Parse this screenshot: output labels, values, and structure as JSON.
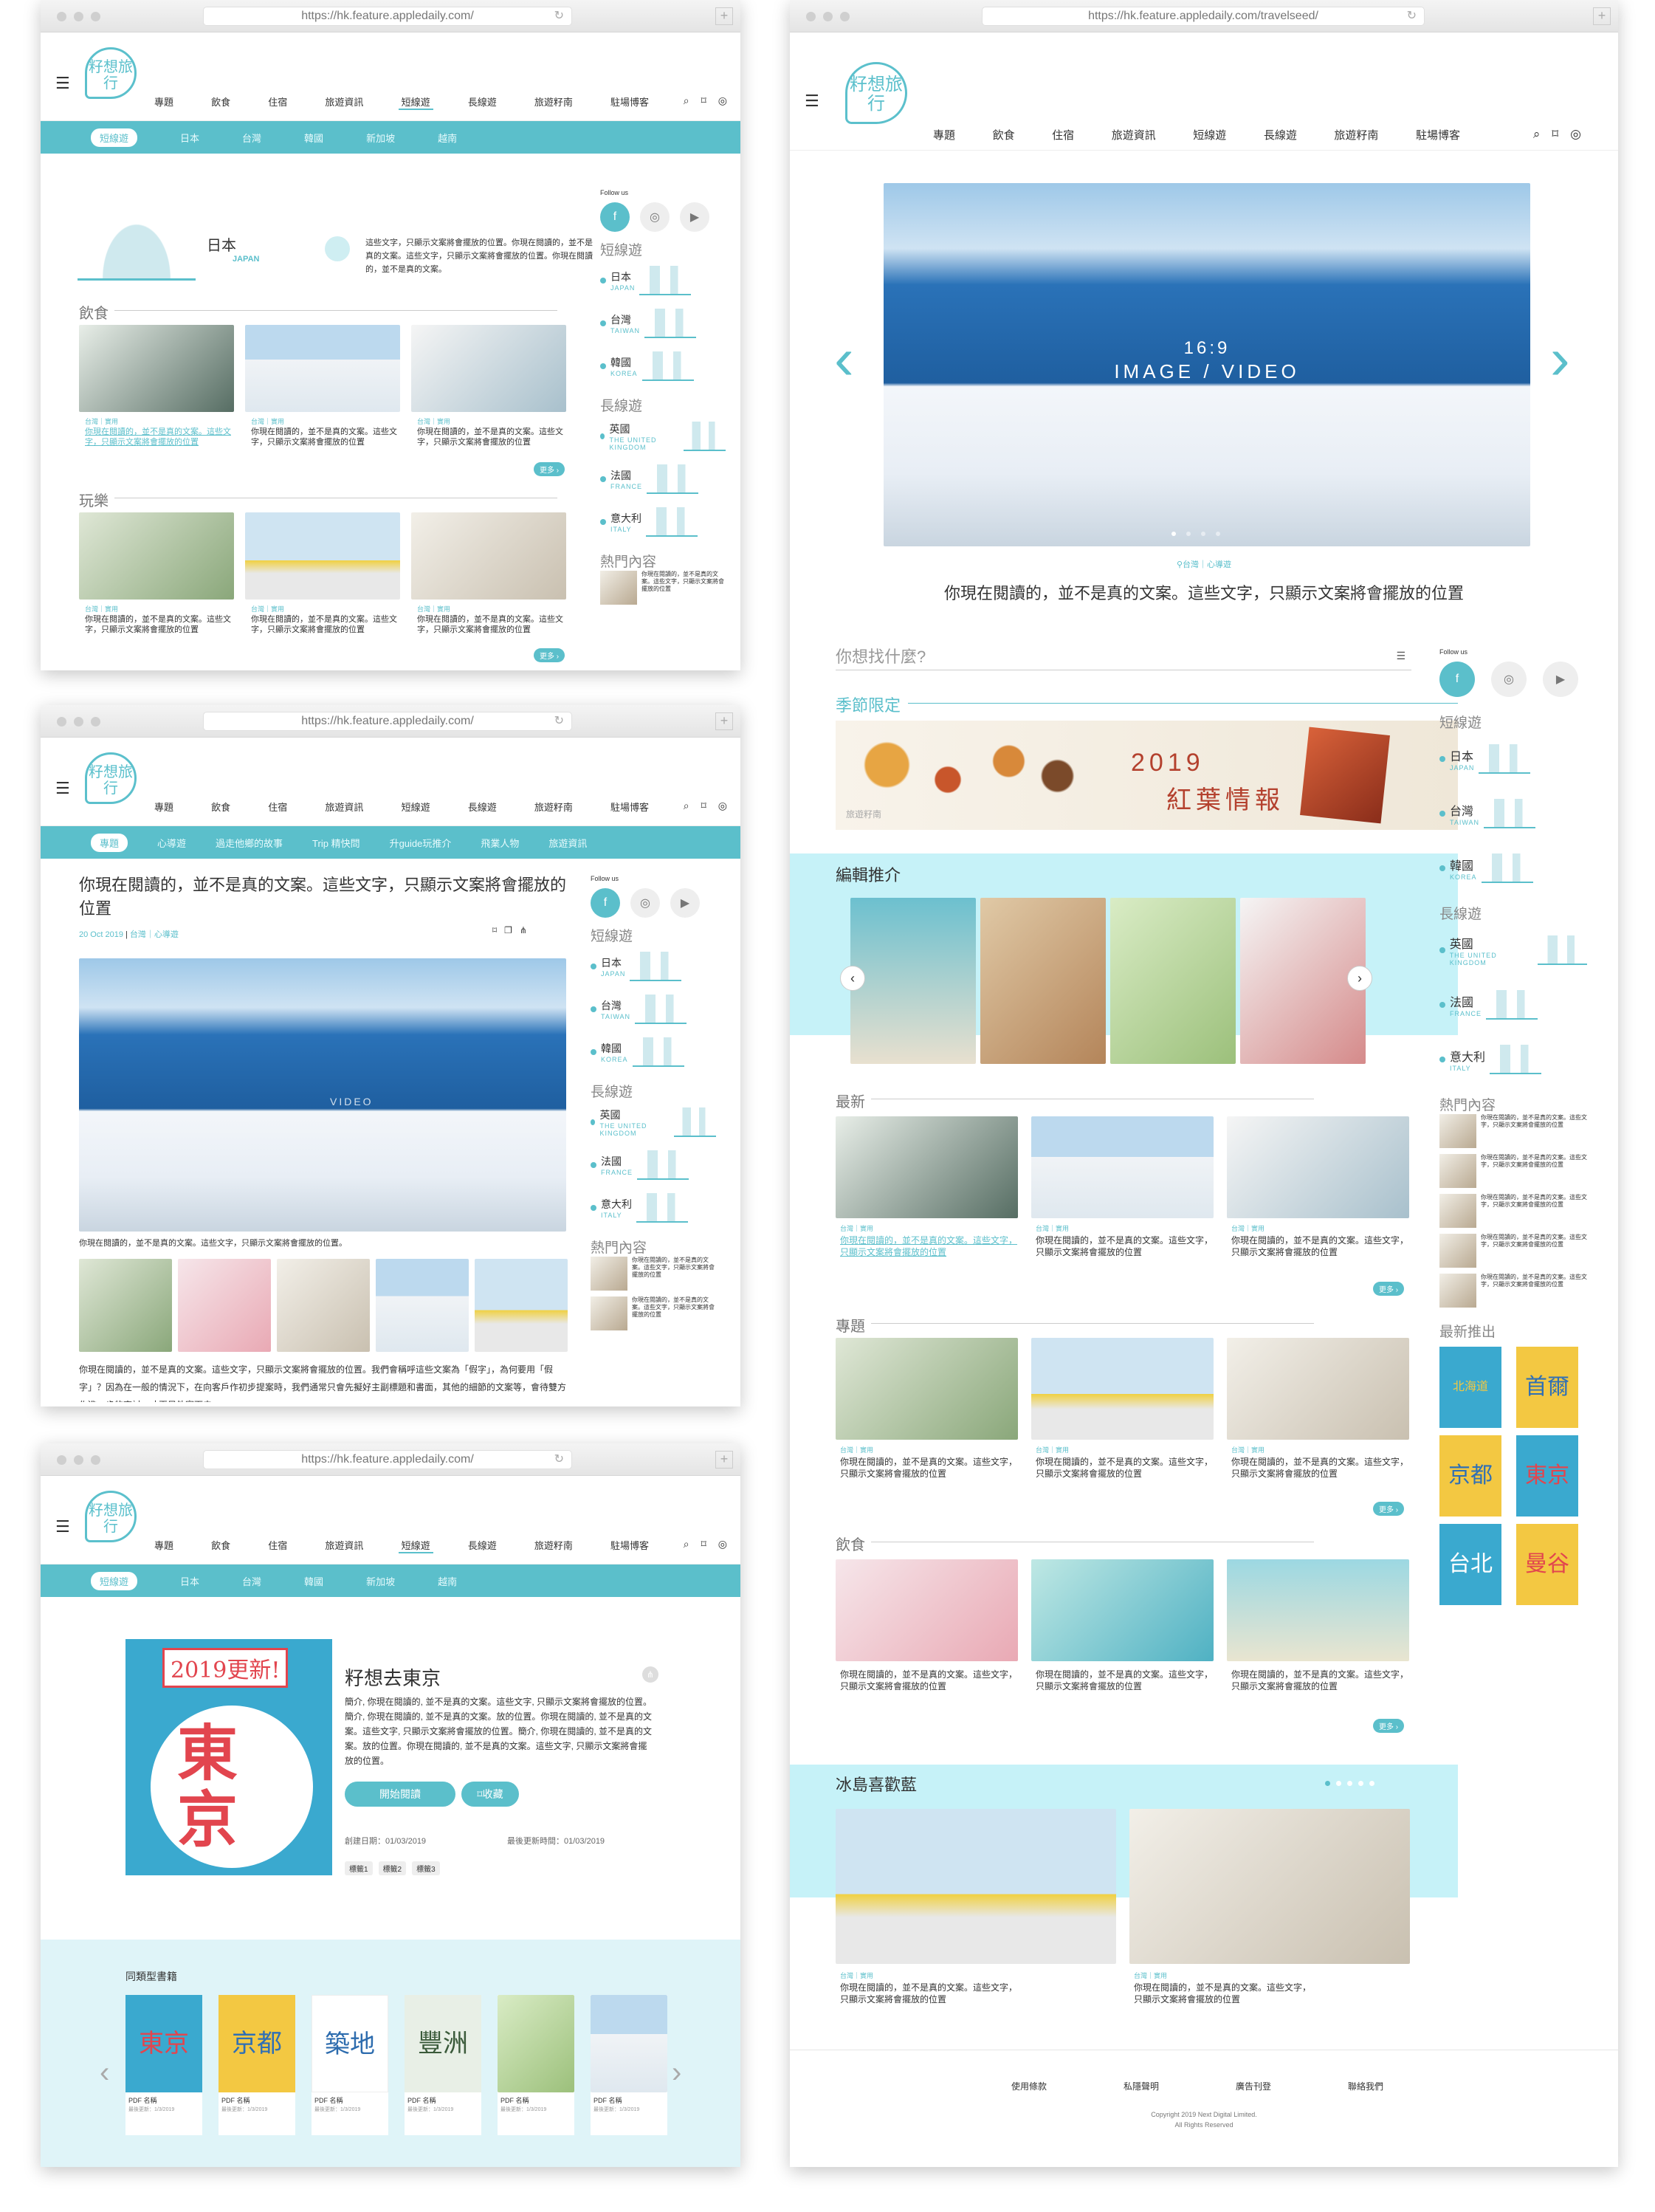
{
  "common": {
    "url": "https://hk.feature.appledaily.com/",
    "logo": "籽想旅行",
    "nav": [
      "專題",
      "飲食",
      "住宿",
      "旅遊資訊",
      "短線遊",
      "長線遊",
      "旅遊籽南",
      "駐場博客"
    ],
    "follow": "Follow us",
    "side_short": "短線遊",
    "side_long": "長線遊",
    "side_hot": "熱門內容",
    "countries": [
      {
        "zh": "日本",
        "en": "JAPAN"
      },
      {
        "zh": "台灣",
        "en": "TAIWAN"
      },
      {
        "zh": "韓國",
        "en": "KOREA"
      },
      {
        "zh": "英國",
        "en": "THE UNITED KINGDOM"
      },
      {
        "zh": "法國",
        "en": "FRANCE"
      },
      {
        "zh": "意大利",
        "en": "ITALY"
      }
    ],
    "placeholder": "你現在閱讀的，並不是真的文案。這些文字，只顯示文案將會擺放的位置",
    "tag": "台灣｜實用",
    "more": "更多 ›",
    "hot_text": "你現在閱讀的，並不是真的文案。這些文字，只顯示文案將會擺放的位置"
  },
  "win1": {
    "subnav": [
      "短線遊",
      "日本",
      "台灣",
      "韓國",
      "新加坡",
      "越南"
    ],
    "hero_zh": "日本",
    "hero_en": "JAPAN",
    "hero_desc": "這些文字，只顯示文案將會擺放的位置。你現在閱讀的，並不是真的文案。這些文字，只顯示文案將會擺放的位置。你現在閱讀的，並不是真的文案。",
    "sec1": "飲食",
    "sec2": "玩樂"
  },
  "win2": {
    "subnav": [
      "專題",
      "心導遊",
      "過走他鄉的故事",
      "Trip 精快問",
      "升guide玩推介",
      "飛業人物",
      "旅遊資訊"
    ],
    "title": "你現在閱讀的，並不是真的文案。這些文字，只顯示文案將會擺放的位置",
    "date": "20 Oct 2019",
    "meta": "台灣｜心導遊",
    "img_caption": "你現在閱讀的，並不是真的文案。這些文字，只顯示文案將會擺放的位置。",
    "watermark": "VIDEO",
    "body": "你現在閱讀的，並不是真的文案。這些文字，只顯示文案將會擺放的位置。我們會稱呼這些文案為「假字」，為何要用「假字」？因為在一般的情況下，在向客戶作初步提案時，我們通常只會先擬好主副標題和書面，其他的細節的文案等，會待雙方作進一步的商討，才再另外寫下去。"
  },
  "win3": {
    "subnav": [
      "短線遊",
      "日本",
      "台灣",
      "韓國",
      "新加坡",
      "越南"
    ],
    "book_badge": "2019更新!",
    "book_city": "東京",
    "book_title": "籽想去東京",
    "book_desc": "簡介, 你現在閱讀的, 並不是真的文案。這些文字, 只顯示文案將會擺放的位置。簡介, 你現在閱讀的, 並不是真的文案。放的位置。你現在閱讀的, 並不是真的文案。這些文字, 只顯示文案將會擺放的位置。簡介, 你現在閱讀的, 並不是真的文案。放的位置。你現在閱讀的, 並不是真的文案。這些文字, 只顯示文案將會擺放的位置。",
    "read_btn": "開始閱讀",
    "fav_btn": "收藏",
    "created": "創建日期：01/03/2019",
    "updated": "最後更新時間：01/03/2019",
    "tags": [
      "標籤1",
      "標籤2",
      "標籤3"
    ],
    "similar": "同類型書籍",
    "pdf_label": "PDF 名稱",
    "pdf_date": "最後更新：1/3/2019",
    "covers": [
      "東京",
      "京都",
      "築地",
      "豐洲",
      "",
      ""
    ]
  },
  "win4": {
    "url": "https://hk.feature.appledaily.com/travelseed/",
    "hero_overlay1": "16:9",
    "hero_overlay2": "IMAGE / VIDEO",
    "hero_tag": "台灣｜心導遊",
    "hero_caption": "你現在閱讀的，並不是真的文案。這些文字，只顯示文案將會擺放的位置",
    "search": "你想找什麼?",
    "season": "季節限定",
    "banner_year": "2019",
    "banner_text": "紅葉情報",
    "banner_small": "旅遊籽南",
    "editor": "編輯推介",
    "latest": "最新",
    "topics": "專題",
    "food": "飲食",
    "iceland": "冰島喜歡藍",
    "new_release": "最新推出",
    "covers": [
      "首爾",
      "京都",
      "東京",
      "台北",
      "曼谷",
      "北海道"
    ],
    "footer": [
      "使用條款",
      "私隱聲明",
      "廣告刊登",
      "聯絡我們"
    ],
    "copyright": "Copyright 2019 Next Digital Limited.",
    "rights": "All Rights Reserved"
  }
}
